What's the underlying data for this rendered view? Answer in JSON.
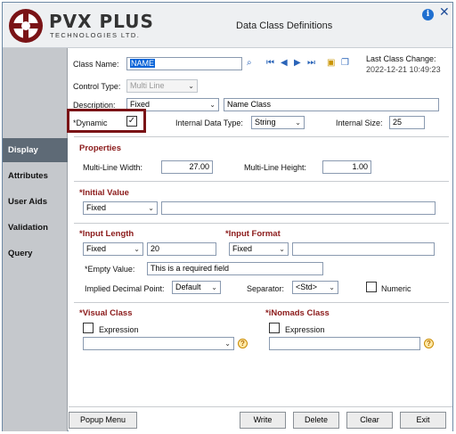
{
  "window": {
    "title": "Data Class Definitions",
    "logo_line1": "PVX PLUS",
    "logo_line2": "TECHNOLOGIES LTD."
  },
  "sidebar": {
    "items": [
      {
        "label": "Display"
      },
      {
        "label": "Attributes"
      },
      {
        "label": "User Aids"
      },
      {
        "label": "Validation"
      },
      {
        "label": "Query"
      }
    ]
  },
  "form": {
    "class_name_label": "Class Name:",
    "class_name_value": "NAME",
    "last_change_label": "Last Class Change:",
    "last_change_value": "2022-12-21 10:49:23",
    "control_type_label": "Control Type:",
    "control_type_value": "Multi Line",
    "description_label": "Description:",
    "description_mode": "Fixed",
    "description_value": "Name Class",
    "dynamic_label": "*Dynamic",
    "dynamic_checked": "✓",
    "internal_type_label": "Internal Data Type:",
    "internal_type_value": "String",
    "internal_size_label": "Internal Size:",
    "internal_size_value": "25"
  },
  "properties": {
    "title": "Properties",
    "multi_width_label": "Multi-Line Width:",
    "multi_width_value": "27.00",
    "multi_height_label": "Multi-Line Height:",
    "multi_height_value": "1.00"
  },
  "initial_value": {
    "title": "*Initial Value",
    "mode": "Fixed",
    "value": ""
  },
  "input": {
    "length_title": "*Input Length",
    "length_mode": "Fixed",
    "length_value": "20",
    "format_title": "*Input Format",
    "format_mode": "Fixed",
    "format_value": "",
    "empty_label": "*Empty Value:",
    "empty_value": "This is a required field",
    "implied_label": "Implied Decimal Point:",
    "implied_value": "Default",
    "separator_label": "Separator:",
    "separator_value": "<Std>",
    "numeric_label": "Numeric"
  },
  "visual_class": {
    "title": "*Visual Class",
    "expression_label": "Expression",
    "value": ""
  },
  "inomads_class": {
    "title": "*iNomads Class",
    "expression_label": "Expression",
    "value": ""
  },
  "buttons": {
    "popup_menu": "Popup Menu",
    "write": "Write",
    "delete": "Delete",
    "clear": "Clear",
    "exit": "Exit"
  },
  "colors": {
    "accent": "#8b1a1a",
    "highlight_border": "#7a1316",
    "sidebar_active": "#5e6a76",
    "sidebar_bg": "#c5c8cc"
  }
}
